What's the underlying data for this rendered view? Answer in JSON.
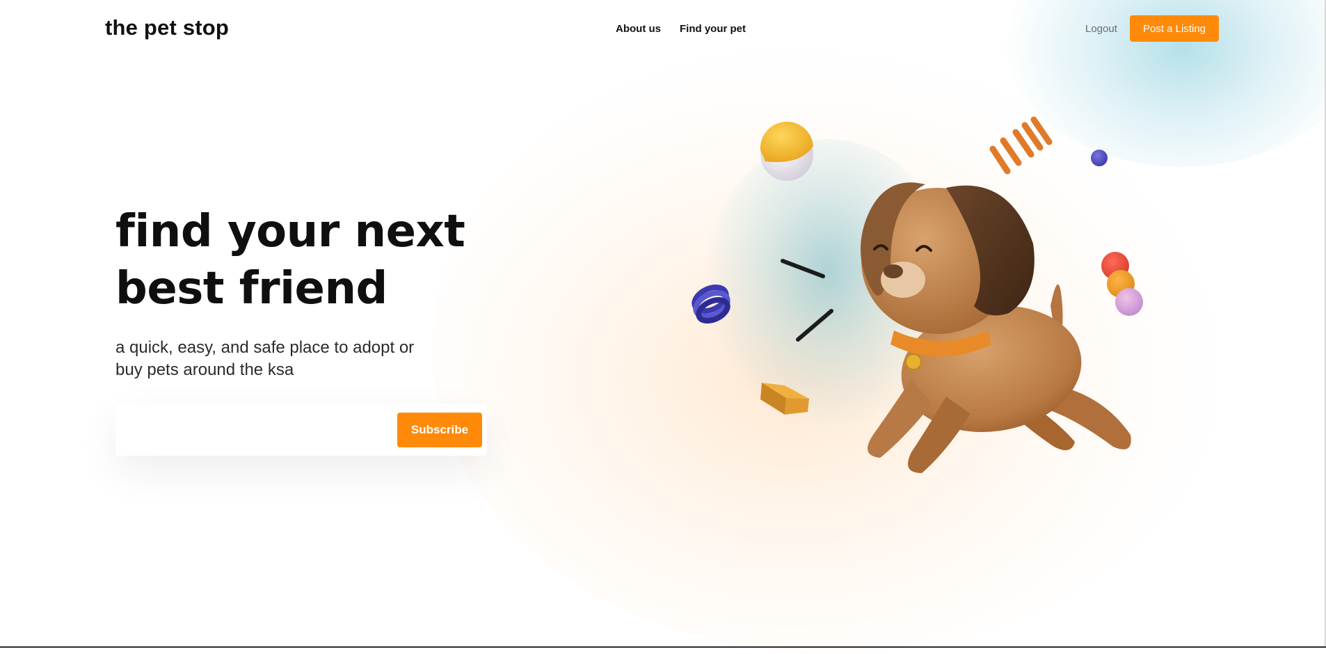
{
  "header": {
    "logo": "the pet stop",
    "nav": [
      {
        "label": "About us"
      },
      {
        "label": "Find your pet"
      }
    ],
    "logout_label": "Logout",
    "post_listing_label": "Post a Listing"
  },
  "hero": {
    "headline": "find your next best friend",
    "subtitle": "a quick, easy, and safe place to adopt or buy pets around the ksa",
    "email_placeholder": "",
    "subscribe_label": "Subscribe"
  },
  "colors": {
    "accent": "#ff8a0a",
    "text": "#111111",
    "glow_orange": "#ffc68c",
    "glow_blue": "#78c8d7"
  },
  "icons": [
    "dog-illustration",
    "ball-icon",
    "spring-icon",
    "coil-icon",
    "block-icon",
    "bead-stack-icon",
    "dot-icon"
  ]
}
